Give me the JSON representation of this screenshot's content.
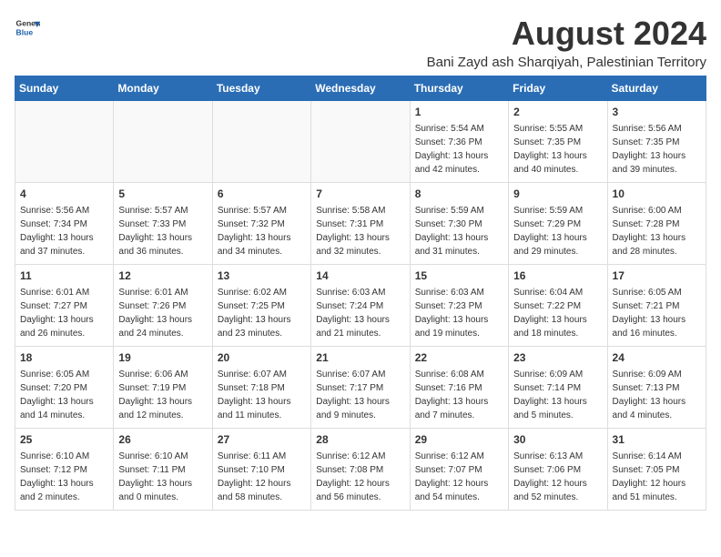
{
  "header": {
    "logo_line1": "General",
    "logo_line2": "Blue",
    "title": "August 2024",
    "subtitle": "Bani Zayd ash Sharqiyah, Palestinian Territory"
  },
  "weekdays": [
    "Sunday",
    "Monday",
    "Tuesday",
    "Wednesday",
    "Thursday",
    "Friday",
    "Saturday"
  ],
  "weeks": [
    [
      {
        "day": "",
        "info": ""
      },
      {
        "day": "",
        "info": ""
      },
      {
        "day": "",
        "info": ""
      },
      {
        "day": "",
        "info": ""
      },
      {
        "day": "1",
        "info": "Sunrise: 5:54 AM\nSunset: 7:36 PM\nDaylight: 13 hours\nand 42 minutes."
      },
      {
        "day": "2",
        "info": "Sunrise: 5:55 AM\nSunset: 7:35 PM\nDaylight: 13 hours\nand 40 minutes."
      },
      {
        "day": "3",
        "info": "Sunrise: 5:56 AM\nSunset: 7:35 PM\nDaylight: 13 hours\nand 39 minutes."
      }
    ],
    [
      {
        "day": "4",
        "info": "Sunrise: 5:56 AM\nSunset: 7:34 PM\nDaylight: 13 hours\nand 37 minutes."
      },
      {
        "day": "5",
        "info": "Sunrise: 5:57 AM\nSunset: 7:33 PM\nDaylight: 13 hours\nand 36 minutes."
      },
      {
        "day": "6",
        "info": "Sunrise: 5:57 AM\nSunset: 7:32 PM\nDaylight: 13 hours\nand 34 minutes."
      },
      {
        "day": "7",
        "info": "Sunrise: 5:58 AM\nSunset: 7:31 PM\nDaylight: 13 hours\nand 32 minutes."
      },
      {
        "day": "8",
        "info": "Sunrise: 5:59 AM\nSunset: 7:30 PM\nDaylight: 13 hours\nand 31 minutes."
      },
      {
        "day": "9",
        "info": "Sunrise: 5:59 AM\nSunset: 7:29 PM\nDaylight: 13 hours\nand 29 minutes."
      },
      {
        "day": "10",
        "info": "Sunrise: 6:00 AM\nSunset: 7:28 PM\nDaylight: 13 hours\nand 28 minutes."
      }
    ],
    [
      {
        "day": "11",
        "info": "Sunrise: 6:01 AM\nSunset: 7:27 PM\nDaylight: 13 hours\nand 26 minutes."
      },
      {
        "day": "12",
        "info": "Sunrise: 6:01 AM\nSunset: 7:26 PM\nDaylight: 13 hours\nand 24 minutes."
      },
      {
        "day": "13",
        "info": "Sunrise: 6:02 AM\nSunset: 7:25 PM\nDaylight: 13 hours\nand 23 minutes."
      },
      {
        "day": "14",
        "info": "Sunrise: 6:03 AM\nSunset: 7:24 PM\nDaylight: 13 hours\nand 21 minutes."
      },
      {
        "day": "15",
        "info": "Sunrise: 6:03 AM\nSunset: 7:23 PM\nDaylight: 13 hours\nand 19 minutes."
      },
      {
        "day": "16",
        "info": "Sunrise: 6:04 AM\nSunset: 7:22 PM\nDaylight: 13 hours\nand 18 minutes."
      },
      {
        "day": "17",
        "info": "Sunrise: 6:05 AM\nSunset: 7:21 PM\nDaylight: 13 hours\nand 16 minutes."
      }
    ],
    [
      {
        "day": "18",
        "info": "Sunrise: 6:05 AM\nSunset: 7:20 PM\nDaylight: 13 hours\nand 14 minutes."
      },
      {
        "day": "19",
        "info": "Sunrise: 6:06 AM\nSunset: 7:19 PM\nDaylight: 13 hours\nand 12 minutes."
      },
      {
        "day": "20",
        "info": "Sunrise: 6:07 AM\nSunset: 7:18 PM\nDaylight: 13 hours\nand 11 minutes."
      },
      {
        "day": "21",
        "info": "Sunrise: 6:07 AM\nSunset: 7:17 PM\nDaylight: 13 hours\nand 9 minutes."
      },
      {
        "day": "22",
        "info": "Sunrise: 6:08 AM\nSunset: 7:16 PM\nDaylight: 13 hours\nand 7 minutes."
      },
      {
        "day": "23",
        "info": "Sunrise: 6:09 AM\nSunset: 7:14 PM\nDaylight: 13 hours\nand 5 minutes."
      },
      {
        "day": "24",
        "info": "Sunrise: 6:09 AM\nSunset: 7:13 PM\nDaylight: 13 hours\nand 4 minutes."
      }
    ],
    [
      {
        "day": "25",
        "info": "Sunrise: 6:10 AM\nSunset: 7:12 PM\nDaylight: 13 hours\nand 2 minutes."
      },
      {
        "day": "26",
        "info": "Sunrise: 6:10 AM\nSunset: 7:11 PM\nDaylight: 13 hours\nand 0 minutes."
      },
      {
        "day": "27",
        "info": "Sunrise: 6:11 AM\nSunset: 7:10 PM\nDaylight: 12 hours\nand 58 minutes."
      },
      {
        "day": "28",
        "info": "Sunrise: 6:12 AM\nSunset: 7:08 PM\nDaylight: 12 hours\nand 56 minutes."
      },
      {
        "day": "29",
        "info": "Sunrise: 6:12 AM\nSunset: 7:07 PM\nDaylight: 12 hours\nand 54 minutes."
      },
      {
        "day": "30",
        "info": "Sunrise: 6:13 AM\nSunset: 7:06 PM\nDaylight: 12 hours\nand 52 minutes."
      },
      {
        "day": "31",
        "info": "Sunrise: 6:14 AM\nSunset: 7:05 PM\nDaylight: 12 hours\nand 51 minutes."
      }
    ]
  ]
}
